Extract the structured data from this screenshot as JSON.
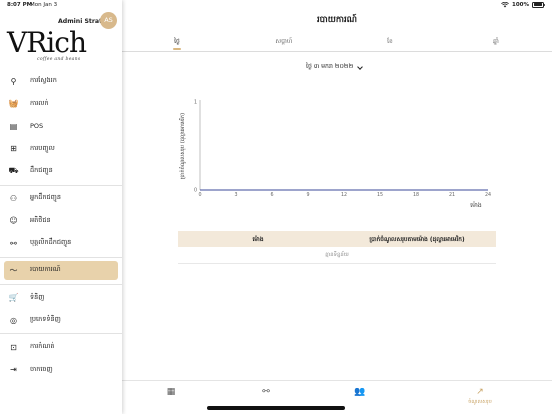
{
  "status_bar": {
    "time": "8:07 PM",
    "date": "Mon Jan 3",
    "battery": "100%"
  },
  "user": {
    "name": "Admini Strator",
    "initials": "AS"
  },
  "logo": {
    "main": "VRich",
    "sub": "coffee and beans"
  },
  "sidebar": {
    "items": [
      {
        "id": "search",
        "label": "ការស្វែងរក",
        "icon": "search-icon",
        "glyph": "⚲",
        "active": false
      },
      {
        "id": "sell",
        "label": "ការលក់",
        "icon": "basket-icon",
        "glyph": "🧺",
        "active": false
      },
      {
        "id": "pos",
        "label": "POS",
        "icon": "register-icon",
        "glyph": "▤",
        "active": false
      },
      {
        "id": "purchase",
        "label": "ការបញ្ចូល",
        "icon": "add-box-icon",
        "glyph": "⊞",
        "active": false
      },
      {
        "id": "delivery",
        "label": "ដឹកជញ្ជូន",
        "icon": "truck-icon",
        "glyph": "⛟",
        "active": false
      },
      {
        "id": "delivery-men",
        "label": "អ្នកដឹកជញ្ជូន",
        "icon": "motorbike-icon",
        "glyph": "⚇",
        "active": false
      },
      {
        "id": "customers",
        "label": "អតិថិជន",
        "icon": "face-icon",
        "glyph": "☺",
        "active": false
      },
      {
        "id": "delivery-staff",
        "label": "បុគ្គលិកដឹកជញ្ជូន",
        "icon": "bicycle-icon",
        "glyph": "⚯",
        "active": false
      },
      {
        "id": "report",
        "label": "របាយការណ៍",
        "icon": "trend-icon",
        "glyph": "〜",
        "active": true
      },
      {
        "id": "products",
        "label": "ទំនិញ",
        "icon": "cart-icon",
        "glyph": "🛒",
        "active": false
      },
      {
        "id": "categories",
        "label": "ប្រភេទទំនិញ",
        "icon": "category-icon",
        "glyph": "◎",
        "active": false
      },
      {
        "id": "settings",
        "label": "ការកំណត់",
        "icon": "settings-box-icon",
        "glyph": "⊡",
        "active": false
      },
      {
        "id": "logout",
        "label": "ចាកចេញ",
        "icon": "logout-icon",
        "glyph": "⇥",
        "active": false
      }
    ]
  },
  "main": {
    "title": "របាយការណ៍",
    "tabs": [
      {
        "label": "ថ្ងៃ",
        "active": true
      },
      {
        "label": "សប្តាហ៍",
        "active": false
      },
      {
        "label": "ខែ",
        "active": false
      },
      {
        "label": "ឆ្នាំ",
        "active": false
      }
    ],
    "date_selector": "ថ្ងៃ ៣ មករា ២០២២"
  },
  "chart_data": {
    "type": "line",
    "title": "",
    "xlabel": "ម៉ោង",
    "ylabel": "ប្រាក់ចំណូលសរុប (ដុល្លារអាមេរិក)",
    "x_ticks": [
      0,
      3,
      6,
      9,
      12,
      15,
      18,
      21,
      24
    ],
    "y_ticks": [
      0,
      1
    ],
    "xlim": [
      0,
      24
    ],
    "ylim": [
      0,
      1
    ],
    "grid": false,
    "series": [
      {
        "color": "#3b4a9a",
        "x": [
          0,
          24
        ],
        "y": [
          0,
          0
        ]
      }
    ]
  },
  "table": {
    "columns": [
      "ម៉ោង",
      "ប្រាក់ចំណូលសរុបតាមម៉ោង (ដុល្លារអាមេរិក)"
    ],
    "empty_text": "គ្មានទិន្នន័យ"
  },
  "bottom_nav": {
    "items": [
      {
        "icon": "dashboard-icon",
        "glyph": "▦",
        "label": "",
        "active": false
      },
      {
        "icon": "bicycle-icon",
        "glyph": "⚯",
        "label": "",
        "active": false
      },
      {
        "icon": "people-icon",
        "glyph": "👥",
        "label": "",
        "active": false
      },
      {
        "icon": "trend-icon",
        "glyph": "↗",
        "label": "ចំណូលសរុប",
        "active": true
      }
    ]
  },
  "colors": {
    "accent": "#d9b780",
    "active_bg": "#e8d2ab",
    "table_header": "#f3e9da",
    "line": "#3b4a9a"
  }
}
